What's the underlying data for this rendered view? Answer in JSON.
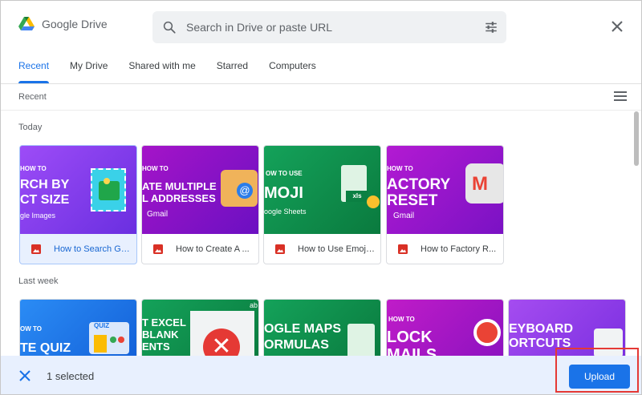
{
  "app": {
    "title": "Google Drive"
  },
  "search": {
    "placeholder": "Search in Drive or paste URL"
  },
  "tabs": [
    {
      "label": "Recent",
      "active": true
    },
    {
      "label": "My Drive",
      "active": false
    },
    {
      "label": "Shared with me",
      "active": false
    },
    {
      "label": "Starred",
      "active": false
    },
    {
      "label": "Computers",
      "active": false
    }
  ],
  "view": {
    "heading": "Recent"
  },
  "sections": {
    "today": {
      "label": "Today",
      "files": [
        {
          "name": "How to Search Go...",
          "selected": true,
          "thumb_lines": [
            "HOW TO",
            "RCH BY",
            "CT SIZE",
            "gle Images"
          ],
          "thumb_color": "#8b3ff2"
        },
        {
          "name": "How to Create A ...",
          "selected": false,
          "thumb_lines": [
            "HOW TO",
            "ATE MULTIPLE",
            "L ADDRESSES",
            "Gmail"
          ],
          "thumb_color": "#8e12c9"
        },
        {
          "name": "How to Use Emoji...",
          "selected": false,
          "thumb_lines": [
            "OW TO USE",
            "MOJI",
            "oogle Sheets",
            "xls"
          ],
          "thumb_color": "#0f8a4a"
        },
        {
          "name": "How to Factory R...",
          "selected": false,
          "thumb_lines": [
            "HOW TO",
            "ACTORY",
            "RESET",
            "Gmail"
          ],
          "thumb_color": "#a014c9"
        }
      ]
    },
    "last_week": {
      "label": "Last week",
      "files": [
        {
          "thumb_lines": [
            "OW TO",
            "TE QUIZ",
            "QUIZ"
          ],
          "thumb_color": "#1e7bef"
        },
        {
          "thumb_lines": [
            "T EXCEL",
            "BLANK",
            "ENTS",
            "ab"
          ],
          "thumb_color": "#0f8a4a"
        },
        {
          "thumb_lines": [
            "OGLE MAPS",
            "ORMULAS"
          ],
          "thumb_color": "#0f8a4a"
        },
        {
          "thumb_lines": [
            "HOW TO",
            "LOCK",
            "MAILS"
          ],
          "thumb_color": "#b215c4"
        },
        {
          "thumb_lines": [
            "EYBOARD",
            "ORTCUTS"
          ],
          "thumb_color": "#9b30e0"
        }
      ]
    }
  },
  "bottom_bar": {
    "selected_text": "1 selected",
    "upload_label": "Upload"
  },
  "colors": {
    "accent": "#1a73e8",
    "selection_bg": "#e8f0fe",
    "highlight": "#e53935"
  }
}
